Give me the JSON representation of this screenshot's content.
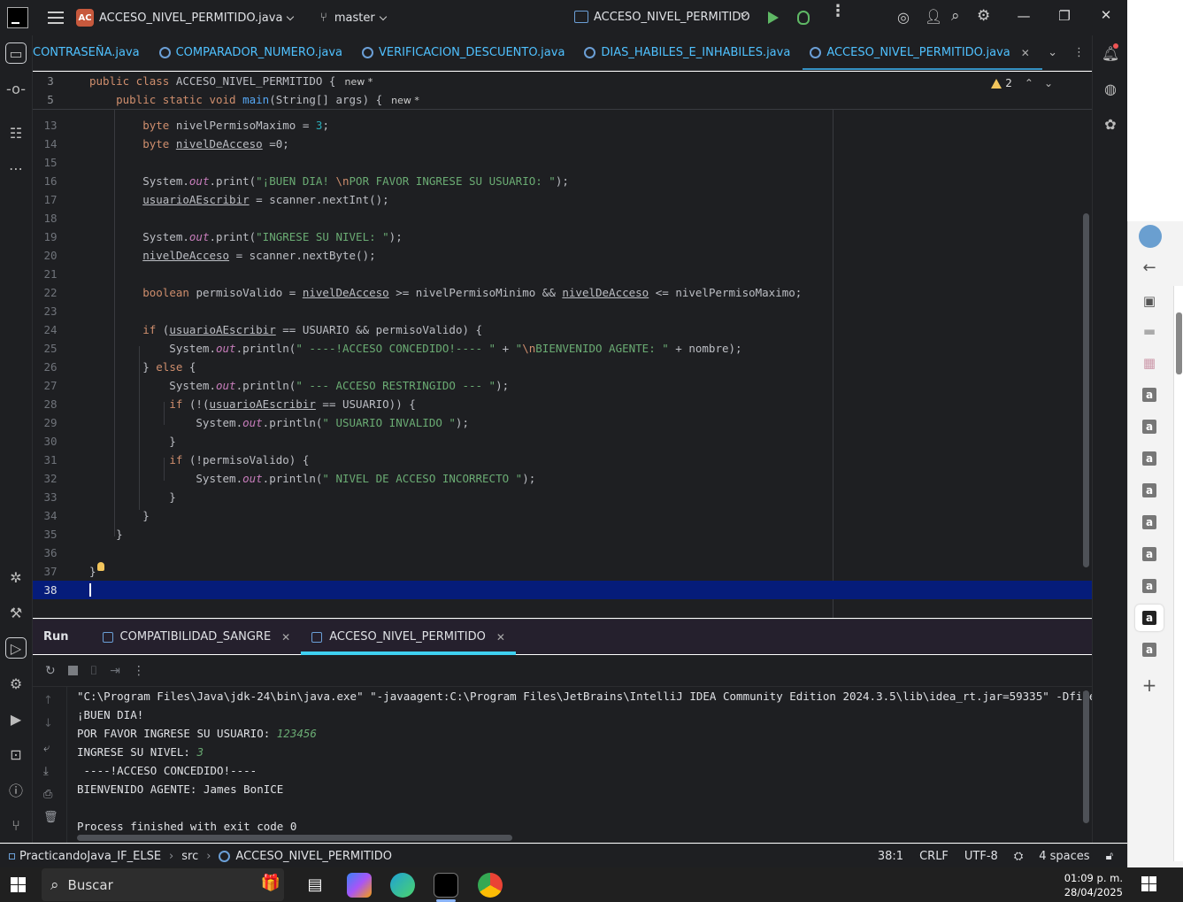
{
  "titlebar": {
    "project_badge": "AC",
    "file_name": "ACCESO_NIVEL_PERMITIDO.java",
    "branch": "master",
    "run_config": "ACCESO_NIVEL_PERMITIDO"
  },
  "tabs": [
    {
      "label": "CONTRASEÑA.java",
      "active": false
    },
    {
      "label": "COMPARADOR_NUMERO.java",
      "active": false
    },
    {
      "label": "VERIFICACION_DESCUENTO.java",
      "active": false
    },
    {
      "label": "DIAS_HABILES_E_INHABILES.java",
      "active": false
    },
    {
      "label": "ACCESO_NIVEL_PERMITIDO.java",
      "active": true
    }
  ],
  "editor": {
    "warning_count": "2",
    "sticky": [
      {
        "ln": "3",
        "code": "public class ACCESO_NIVEL_PERMITIDO {",
        "tag": "new *"
      },
      {
        "ln": "5",
        "code": "    public static void main(String[] args) {",
        "tag": "new *"
      }
    ],
    "line_numbers": [
      "13",
      "14",
      "15",
      "16",
      "17",
      "18",
      "19",
      "20",
      "21",
      "22",
      "23",
      "24",
      "25",
      "26",
      "27",
      "28",
      "29",
      "30",
      "31",
      "32",
      "33",
      "34",
      "35",
      "36",
      "37",
      "38"
    ],
    "current_line": "38"
  },
  "run_panel": {
    "title": "Run",
    "tabs": [
      {
        "label": "COMPATIBILIDAD_SANGRE",
        "active": false
      },
      {
        "label": "ACCESO_NIVEL_PERMITIDO",
        "active": true
      }
    ],
    "console": {
      "command": "\"C:\\Program Files\\Java\\jdk-24\\bin\\java.exe\" \"-javaagent:C:\\Program Files\\JetBrains\\IntelliJ IDEA Community Edition 2024.3.5\\lib\\idea_rt.jar=59335\" -Dfile.encoding=",
      "greeting": "¡BUEN DIA!",
      "prompt_user": "POR FAVOR INGRESE SU USUARIO: ",
      "input_user": "123456",
      "prompt_level": "INGRESE SU NIVEL: ",
      "input_level": "3",
      "granted": " ----!ACCESO CONCEDIDO!----",
      "welcome": "BIENVENIDO AGENTE: James BonICE",
      "exit": "Process finished with exit code 0"
    }
  },
  "statusbar": {
    "project": "PracticandoJava_IF_ELSE",
    "folder": "src",
    "file": "ACCESO_NIVEL_PERMITIDO",
    "position": "38:1",
    "line_sep": "CRLF",
    "encoding": "UTF-8",
    "indent": "4 spaces"
  },
  "taskbar": {
    "search_placeholder": "Buscar",
    "time": "01:09 p. m.",
    "date": "28/04/2025"
  },
  "colors": {
    "editor_bg": "#1e1f22",
    "keyword": "#cf8e6d",
    "string": "#6aab73",
    "number": "#2aacb8",
    "field": "#c77dbb",
    "current_line": "#051c7a",
    "run_tab_accent": "#3fd0f0"
  }
}
